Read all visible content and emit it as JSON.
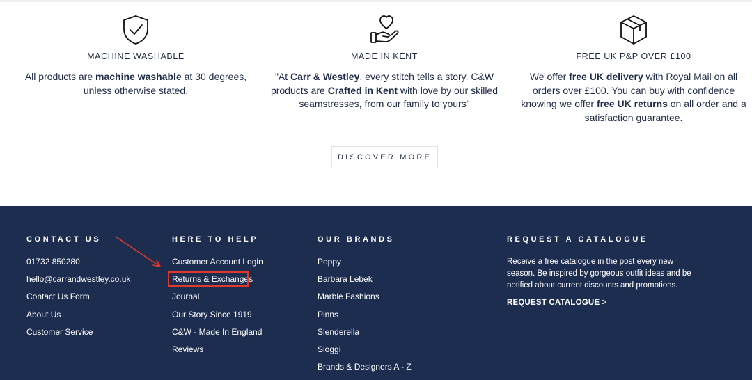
{
  "features": [
    {
      "icon": "shield-check-icon",
      "title": "MACHINE WASHABLE",
      "parts": [
        [
          "All products are ",
          false
        ],
        [
          "machine washable",
          true
        ],
        [
          " at 30 degrees, unless otherwise stated.",
          false
        ]
      ]
    },
    {
      "icon": "heart-hand-icon",
      "title": "MADE IN KENT",
      "parts": [
        [
          "\"At ",
          false
        ],
        [
          "Carr & Westley",
          true
        ],
        [
          ", every stitch tells a story. C&W products are ",
          false
        ],
        [
          "Crafted in Kent",
          true
        ],
        [
          " with love by our skilled seamstresses, from our family to yours\"",
          false
        ]
      ]
    },
    {
      "icon": "box-icon",
      "title": "FREE UK P&P OVER £100",
      "parts": [
        [
          "We offer ",
          false
        ],
        [
          "free UK delivery",
          true
        ],
        [
          " with Royal Mail on all orders over £100. You can buy with confidence knowing we offer ",
          false
        ],
        [
          "free UK returns",
          true
        ],
        [
          " on all order and a satisfaction guarantee.",
          false
        ]
      ]
    }
  ],
  "discover_label": "DISCOVER MORE",
  "footer": {
    "contact": {
      "heading": "CONTACT US",
      "items": [
        "01732 850280",
        "hello@carrandwestley.co.uk",
        "Contact Us Form",
        "About Us",
        "Customer Service"
      ]
    },
    "help": {
      "heading": "HERE TO HELP",
      "items": [
        "Customer Account Login",
        "Returns & Exchanges",
        "Journal",
        "Our Story Since 1919",
        "C&W - Made In England",
        "Reviews"
      ]
    },
    "brands": {
      "heading": "OUR BRANDS",
      "items": [
        "Poppy",
        "Barbara Lebek",
        "Marble Fashions",
        "Pinns",
        "Slenderella",
        "Sloggi",
        "Brands & Designers A - Z"
      ]
    },
    "catalogue": {
      "heading": "REQUEST A CATALOGUE",
      "text": "Receive a free catalogue in the post every new season. Be inspired by gorgeous outfit ideas and be notified about current discounts and promotions.",
      "link": "REQUEST CATALOGUE >"
    }
  },
  "colors": {
    "footer_bg": "#1d2d4f",
    "text_navy": "#1e2a46",
    "annotation_red": "#e0392b"
  }
}
